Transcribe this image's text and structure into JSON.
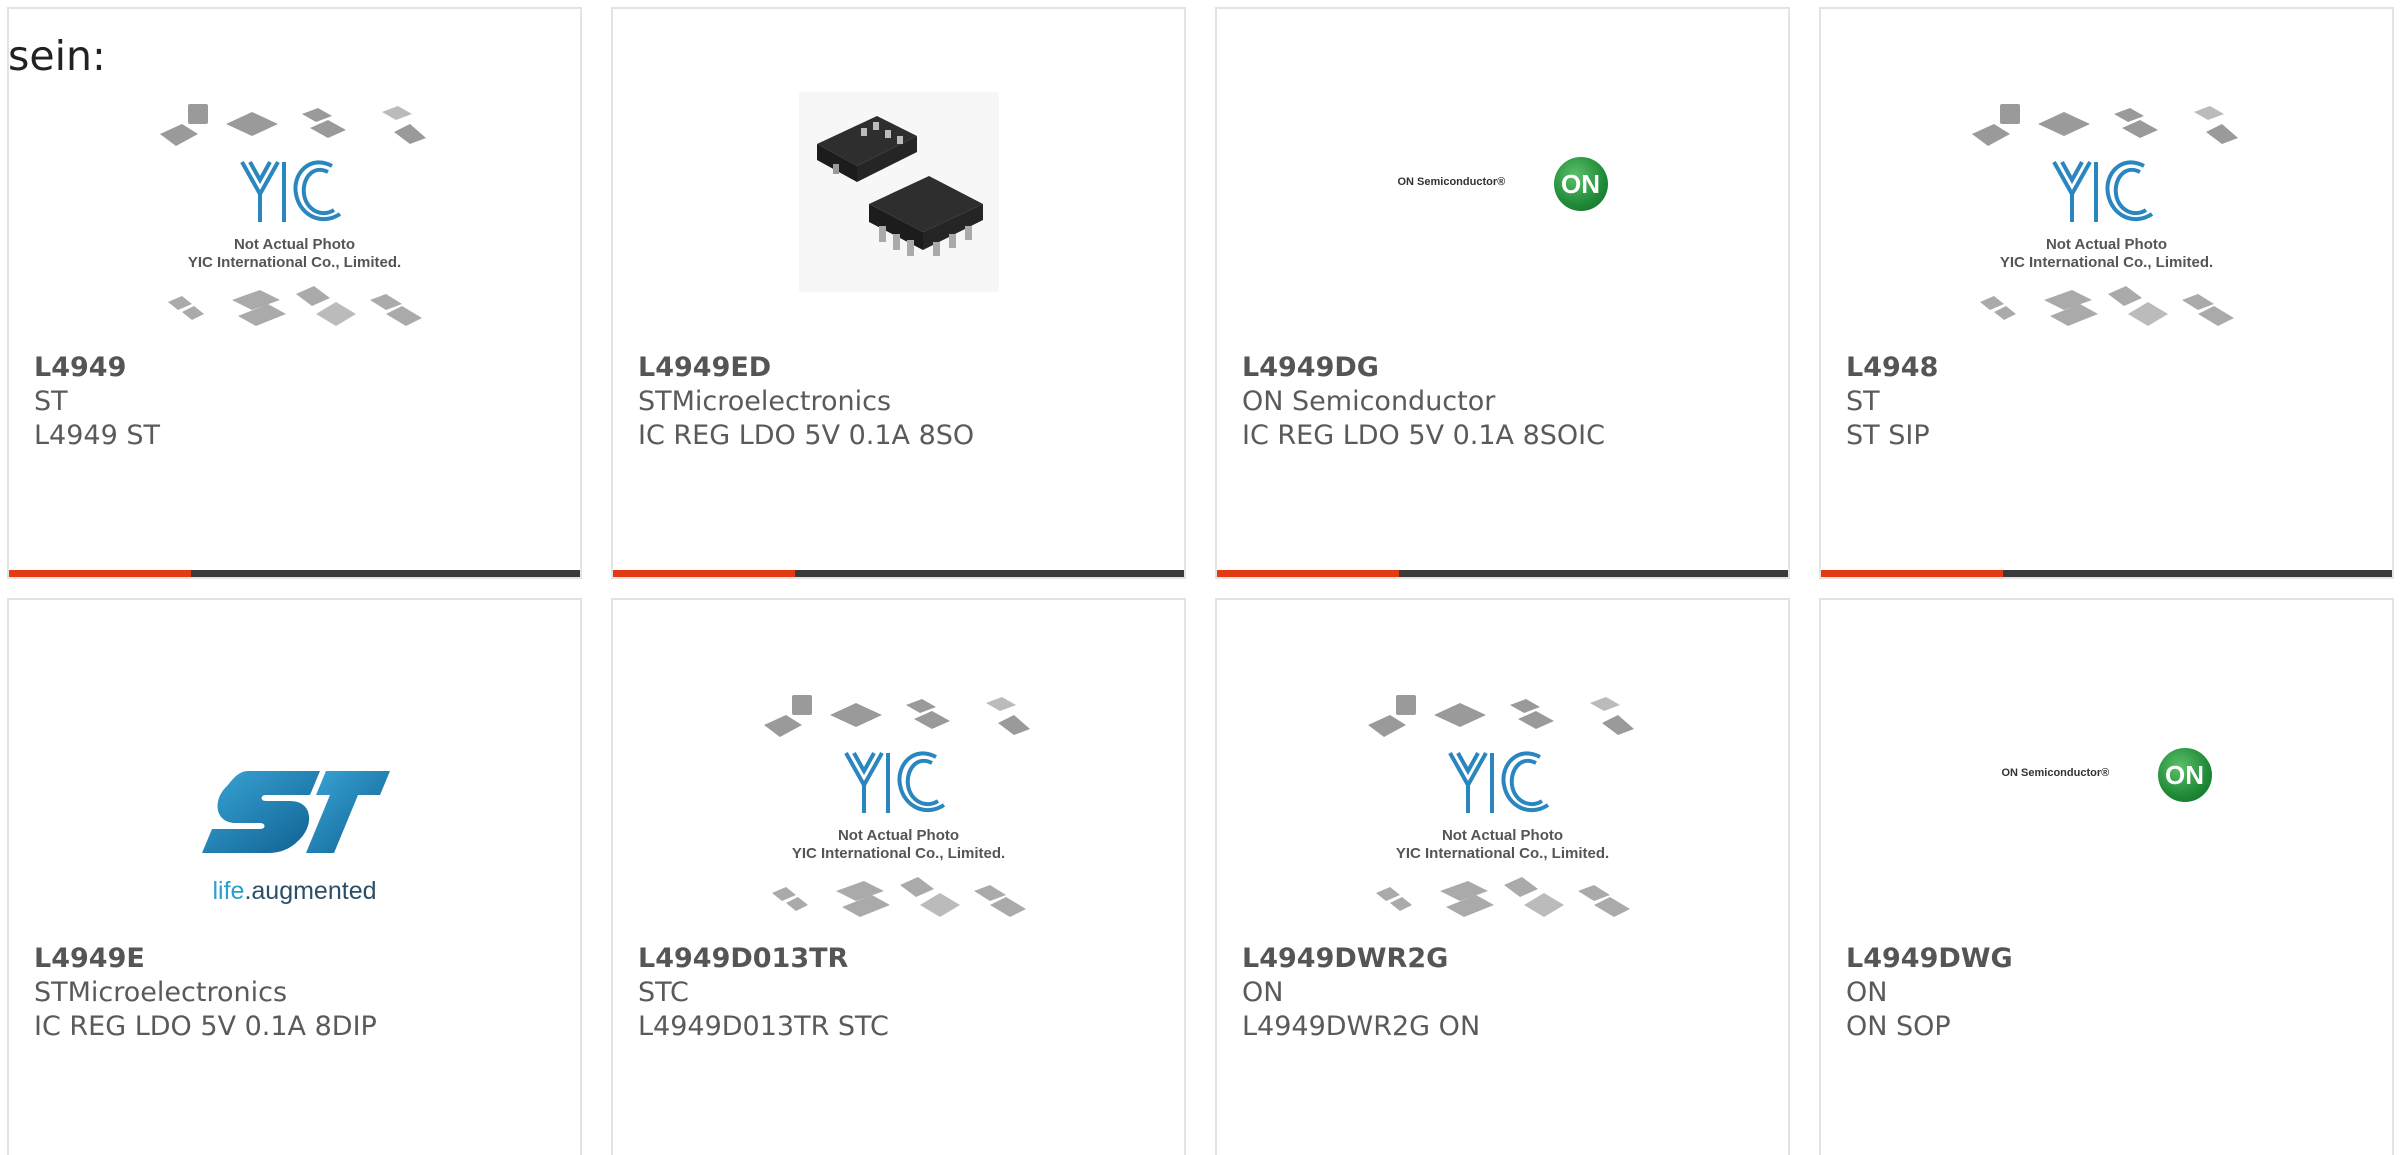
{
  "intro_text": "sein:",
  "colors": {
    "accent": "#e23b14",
    "bar": "#3a3a3a",
    "border": "#e3e3e3",
    "text": "#5a5a5a"
  },
  "placeholder_caption": {
    "line1": "Not Actual Photo",
    "line2": "YIC International Co., Limited."
  },
  "logos": {
    "on_text": "ON Semiconductor®",
    "on_circle": "ON",
    "st_tag_life": "life",
    "st_tag_rest": ".augmented"
  },
  "products": [
    {
      "part": "L4949",
      "maker": "ST",
      "desc": "L4949 ST",
      "image": "yic-placeholder-icon"
    },
    {
      "part": "L4949ED",
      "maker": "STMicroelectronics",
      "desc": "IC REG LDO 5V 0.1A 8SO",
      "image": "chip-photo"
    },
    {
      "part": "L4949DG",
      "maker": "ON Semiconductor",
      "desc": "IC REG LDO 5V 0.1A 8SOIC",
      "image": "on-semiconductor-logo"
    },
    {
      "part": "L4948",
      "maker": "ST",
      "desc": "ST SIP",
      "image": "yic-placeholder-icon"
    },
    {
      "part": "L4949E",
      "maker": "STMicroelectronics",
      "desc": "IC REG LDO 5V 0.1A 8DIP",
      "image": "st-logo"
    },
    {
      "part": "L4949D013TR",
      "maker": "STC",
      "desc": "L4949D013TR STC",
      "image": "yic-placeholder-icon"
    },
    {
      "part": "L4949DWR2G",
      "maker": "ON",
      "desc": "L4949DWR2G ON",
      "image": "yic-placeholder-icon"
    },
    {
      "part": "L4949DWG",
      "maker": "ON",
      "desc": "ON SOP",
      "image": "on-semiconductor-logo"
    }
  ]
}
